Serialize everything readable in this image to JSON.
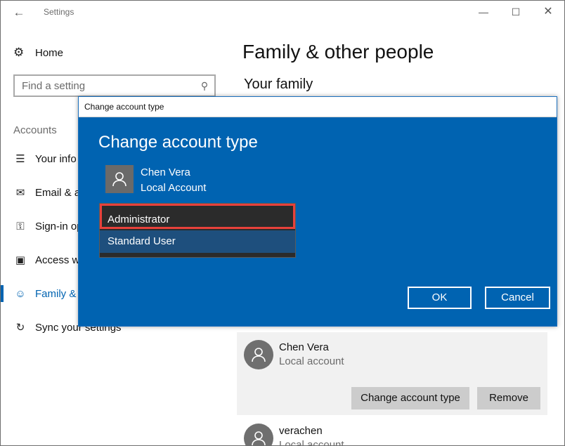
{
  "window": {
    "title": "Settings",
    "back_icon": "arrow-left-icon",
    "min_glyph": "—",
    "max_glyph": "☐",
    "close_glyph": "✕"
  },
  "sidebar": {
    "home_label": "Home",
    "search_placeholder": "Find a setting",
    "section_label": "Accounts",
    "items": [
      {
        "label": "Your info",
        "icon": "person-card-icon",
        "glyph": "☰"
      },
      {
        "label": "Email & app accounts",
        "icon": "email-icon",
        "glyph": "✉"
      },
      {
        "label": "Sign-in options",
        "icon": "key-icon",
        "glyph": "⚿"
      },
      {
        "label": "Access work or school",
        "icon": "briefcase-icon",
        "glyph": "▣"
      },
      {
        "label": "Family & other people",
        "icon": "person-add-icon",
        "glyph": "☺"
      },
      {
        "label": "Sync your settings",
        "icon": "sync-icon",
        "glyph": "↻"
      }
    ]
  },
  "main": {
    "title": "Family & other people",
    "family_heading": "Your family",
    "account": {
      "name": "Chen Vera",
      "type": "Local account",
      "change_label": "Change account type",
      "remove_label": "Remove"
    },
    "other_account": {
      "name": "verachen",
      "type": "Local account"
    }
  },
  "dialog": {
    "window_title": "Change account type",
    "heading": "Change account type",
    "user_name": "Chen Vera",
    "user_type": "Local Account",
    "options": [
      "Administrator",
      "Standard User"
    ],
    "selected": "Administrator",
    "ok_label": "OK",
    "cancel_label": "Cancel"
  },
  "colors": {
    "accent": "#0063b1",
    "highlight_border": "#e8413b",
    "dropdown_bg": "#2b2b2b"
  }
}
